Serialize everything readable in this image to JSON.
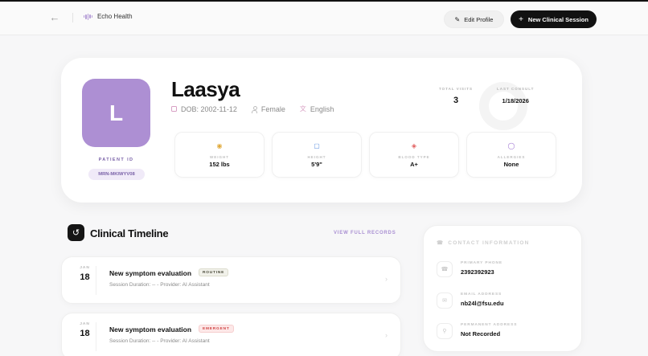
{
  "app": {
    "name": "Echo Health"
  },
  "toolbar": {
    "edit_label": "Edit Profile",
    "new_label": "New Clinical Session"
  },
  "patient": {
    "initial": "L",
    "name": "Laasya",
    "dob": "DOB: 2002-11-12",
    "gender": "Female",
    "language": "English",
    "id_label": "PATIENT ID",
    "id_value": "MRN-MKIWYV08"
  },
  "stats": [
    {
      "label": "TOTAL VISITS",
      "value": "3"
    },
    {
      "label": "LAST CONSULT",
      "value": "1/18/2026"
    }
  ],
  "vitals": [
    {
      "label": "WEIGHT",
      "value": "152 lbs",
      "icon": "weight-icon",
      "color": "#e0a93a"
    },
    {
      "label": "HEIGHT",
      "value": "5'9\"",
      "icon": "ruler-icon",
      "color": "#5b8fe0"
    },
    {
      "label": "BLOOD TYPE",
      "value": "A+",
      "icon": "droplet-icon",
      "color": "#e05a5a"
    },
    {
      "label": "ALLERGIES",
      "value": "None",
      "icon": "shield-icon",
      "color": "#9b6fd0"
    }
  ],
  "timeline": {
    "title": "Clinical Timeline",
    "link": "VIEW FULL RECORDS",
    "sessions": [
      {
        "month": "JAN",
        "day": "18",
        "title": "New symptom evaluation",
        "badge": "ROUTINE",
        "sub": "Session Duration: -- - Provider: AI Assistant"
      },
      {
        "month": "JAN",
        "day": "18",
        "title": "New symptom evaluation",
        "badge": "EMERGENT",
        "sub": "Session Duration: -- - Provider: AI Assistant"
      }
    ]
  },
  "contact": {
    "title": "CONTACT INFORMATION",
    "rows": [
      {
        "label": "PRIMARY PHONE",
        "value": "2392392923",
        "icon": "phone-icon"
      },
      {
        "label": "EMAIL ADDRESS",
        "value": "nb24l@fsu.edu",
        "icon": "mail-icon"
      },
      {
        "label": "PERMANENT ADDRESS",
        "value": "Not Recorded",
        "icon": "location-icon"
      }
    ]
  }
}
